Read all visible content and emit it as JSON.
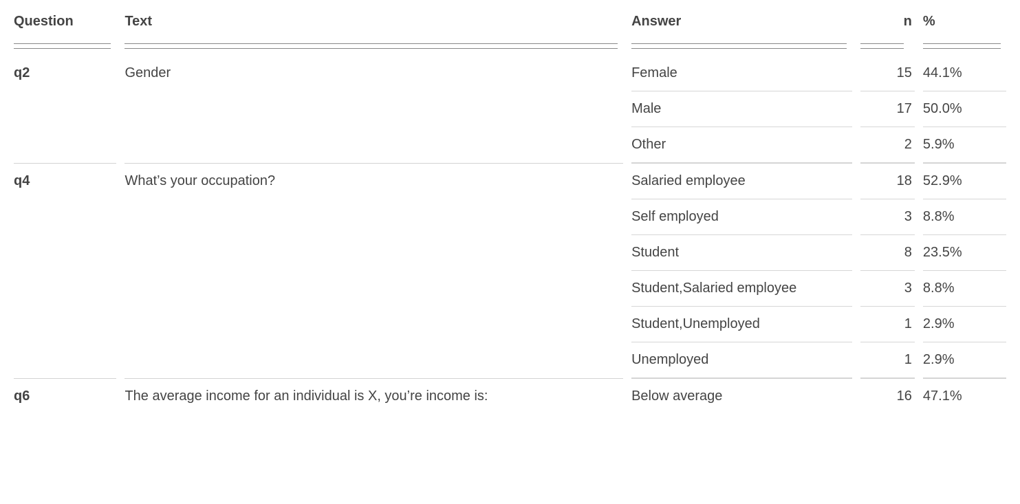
{
  "headers": {
    "question": "Question",
    "text": "Text",
    "answer": "Answer",
    "n": "n",
    "pct": "%"
  },
  "groups": [
    {
      "id": "q2",
      "text": "Gender",
      "answers": [
        {
          "label": "Female",
          "n": "15",
          "pct": "44.1%"
        },
        {
          "label": "Male",
          "n": "17",
          "pct": "50.0%"
        },
        {
          "label": "Other",
          "n": "2",
          "pct": "5.9%"
        }
      ]
    },
    {
      "id": "q4",
      "text": "What’s your occupation?",
      "answers": [
        {
          "label": "Salaried employee",
          "n": "18",
          "pct": "52.9%"
        },
        {
          "label": "Self employed",
          "n": "3",
          "pct": "8.8%"
        },
        {
          "label": "Student",
          "n": "8",
          "pct": "23.5%"
        },
        {
          "label": "Student,Salaried employee",
          "n": "3",
          "pct": "8.8%"
        },
        {
          "label": "Student,Unemployed",
          "n": "1",
          "pct": "2.9%"
        },
        {
          "label": "Unemployed",
          "n": "1",
          "pct": "2.9%"
        }
      ]
    },
    {
      "id": "q6",
      "text": "The average income for an individual is X, you’re income is:",
      "answers": [
        {
          "label": "Below average",
          "n": "16",
          "pct": "47.1%"
        }
      ]
    }
  ]
}
